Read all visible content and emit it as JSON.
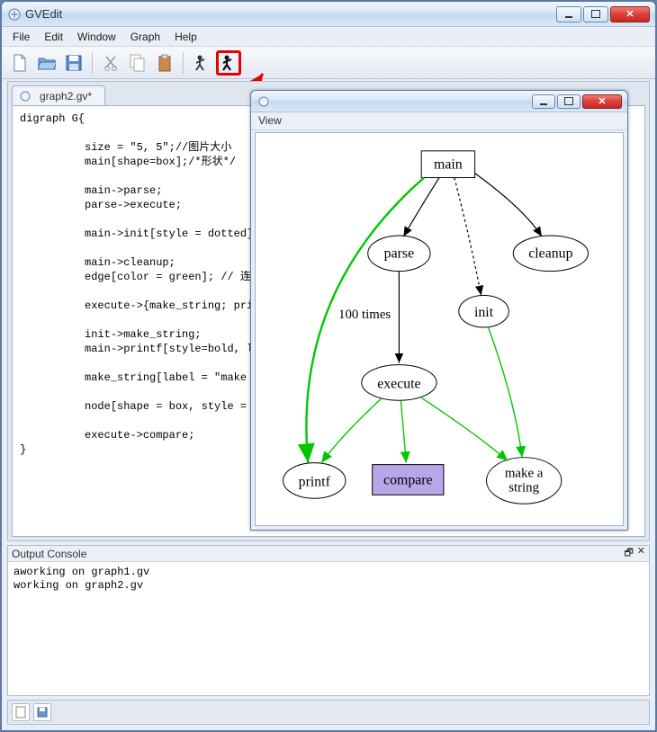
{
  "window": {
    "title": "GVEdit"
  },
  "menus": {
    "file": "File",
    "edit": "Edit",
    "window": "Window",
    "graph": "Graph",
    "help": "Help"
  },
  "doc": {
    "tab": "graph2.gv*"
  },
  "editor_code": "digraph G{\n\n          size = \"5, 5\";//图片大小\n          main[shape=box];/*形状*/\n\n          main->parse;\n          parse->execute;\n\n          main->init[style = dotted];//\n\n          main->cleanup;\n          edge[color = green]; // 连接\n\n          execute->{make_string; print\n\n          init->make_string;\n          main->printf[style=bold, lab\n\n          make_string[label = \"make a\\\n\n          node[shape = box, style = fi\n\n          execute->compare;\n}",
  "console": {
    "title": "Output Console",
    "line1": "aworking on graph1.gv",
    "line2": "working on graph2.gv"
  },
  "view": {
    "title": "View"
  },
  "graph_nodes": {
    "main": "main",
    "parse": "parse",
    "cleanup": "cleanup",
    "init": "init",
    "execute": "execute",
    "printf": "printf",
    "compare": "compare",
    "make_string": "make a\nstring",
    "edge_label": "100 times"
  },
  "chart_data": {
    "type": "diagram",
    "graph_type": "digraph",
    "name": "G",
    "nodes": [
      {
        "id": "main",
        "label": "main",
        "shape": "box"
      },
      {
        "id": "parse",
        "label": "parse",
        "shape": "ellipse"
      },
      {
        "id": "cleanup",
        "label": "cleanup",
        "shape": "ellipse"
      },
      {
        "id": "init",
        "label": "init",
        "shape": "ellipse"
      },
      {
        "id": "execute",
        "label": "execute",
        "shape": "ellipse"
      },
      {
        "id": "printf",
        "label": "printf",
        "shape": "ellipse"
      },
      {
        "id": "compare",
        "label": "compare",
        "shape": "box",
        "style": "filled",
        "fillcolor": "#b8a6e8"
      },
      {
        "id": "make_string",
        "label": "make a\\nstring",
        "shape": "ellipse"
      }
    ],
    "edges": [
      {
        "from": "main",
        "to": "parse",
        "color": "black"
      },
      {
        "from": "parse",
        "to": "execute",
        "color": "black",
        "label": "100 times"
      },
      {
        "from": "main",
        "to": "init",
        "color": "black",
        "style": "dotted"
      },
      {
        "from": "main",
        "to": "cleanup",
        "color": "black"
      },
      {
        "from": "main",
        "to": "printf",
        "color": "green",
        "style": "bold"
      },
      {
        "from": "execute",
        "to": "make_string",
        "color": "green"
      },
      {
        "from": "execute",
        "to": "printf",
        "color": "green"
      },
      {
        "from": "init",
        "to": "make_string",
        "color": "green"
      },
      {
        "from": "execute",
        "to": "compare",
        "color": "green"
      }
    ]
  }
}
